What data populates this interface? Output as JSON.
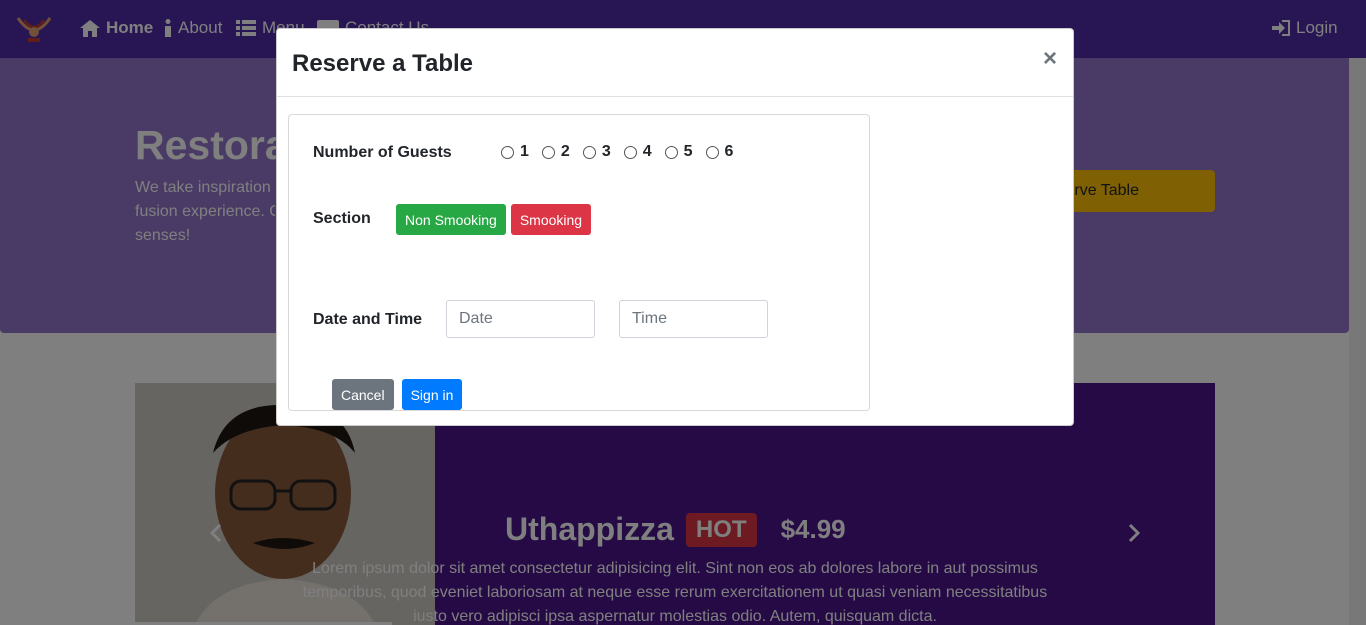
{
  "navbar": {
    "links": [
      {
        "label": "Home"
      },
      {
        "label": "About"
      },
      {
        "label": "Menu"
      },
      {
        "label": "Contact Us"
      }
    ],
    "login_label": "Login"
  },
  "jumbotron": {
    "title": "Restorante",
    "text_lines": [
      "We take inspiration",
      "fusion experience. O",
      "senses!"
    ],
    "reserve_label": "Reserve Table"
  },
  "carousel": {
    "dish_name": "Uthappizza",
    "badge": "HOT",
    "price": "$4.99",
    "desc_lines": [
      "Lorem ipsum dolor sit amet consectetur adipisicing elit. Sint non eos ab dolores labore in aut possimus",
      "temporibus, quod eveniet laboriosam at neque esse rerum exercitationem ut quasi veniam necessitatibus",
      "iusto vero adipisci ipsa aspernatur molestias odio. Autem, quisquam dicta."
    ]
  },
  "modal": {
    "title": "Reserve a Table",
    "close_glyph": "×",
    "guests_label": "Number of Guests",
    "guest_options": [
      "1",
      "2",
      "3",
      "4",
      "5",
      "6"
    ],
    "section_label": "Section",
    "non_smoking_label": "Non Smooking",
    "smoking_label": "Smooking",
    "datetime_label": "Date and Time",
    "date_placeholder": "Date",
    "time_placeholder": "Time",
    "cancel_label": "Cancel",
    "submit_label": "Sign in"
  },
  "colors": {
    "navbar": "#512da8",
    "jumbotron": "#9575cd",
    "carousel": "#4a148c",
    "warning": "#ffc107",
    "success": "#28a745",
    "danger": "#dc3545",
    "primary": "#007bff",
    "secondary": "#6c757d"
  },
  "icons": [
    "logo-icon",
    "home-icon",
    "info-icon",
    "list-icon",
    "address-card-icon",
    "sign-in-icon",
    "close-icon",
    "chevron-left-icon",
    "chevron-right-icon"
  ]
}
